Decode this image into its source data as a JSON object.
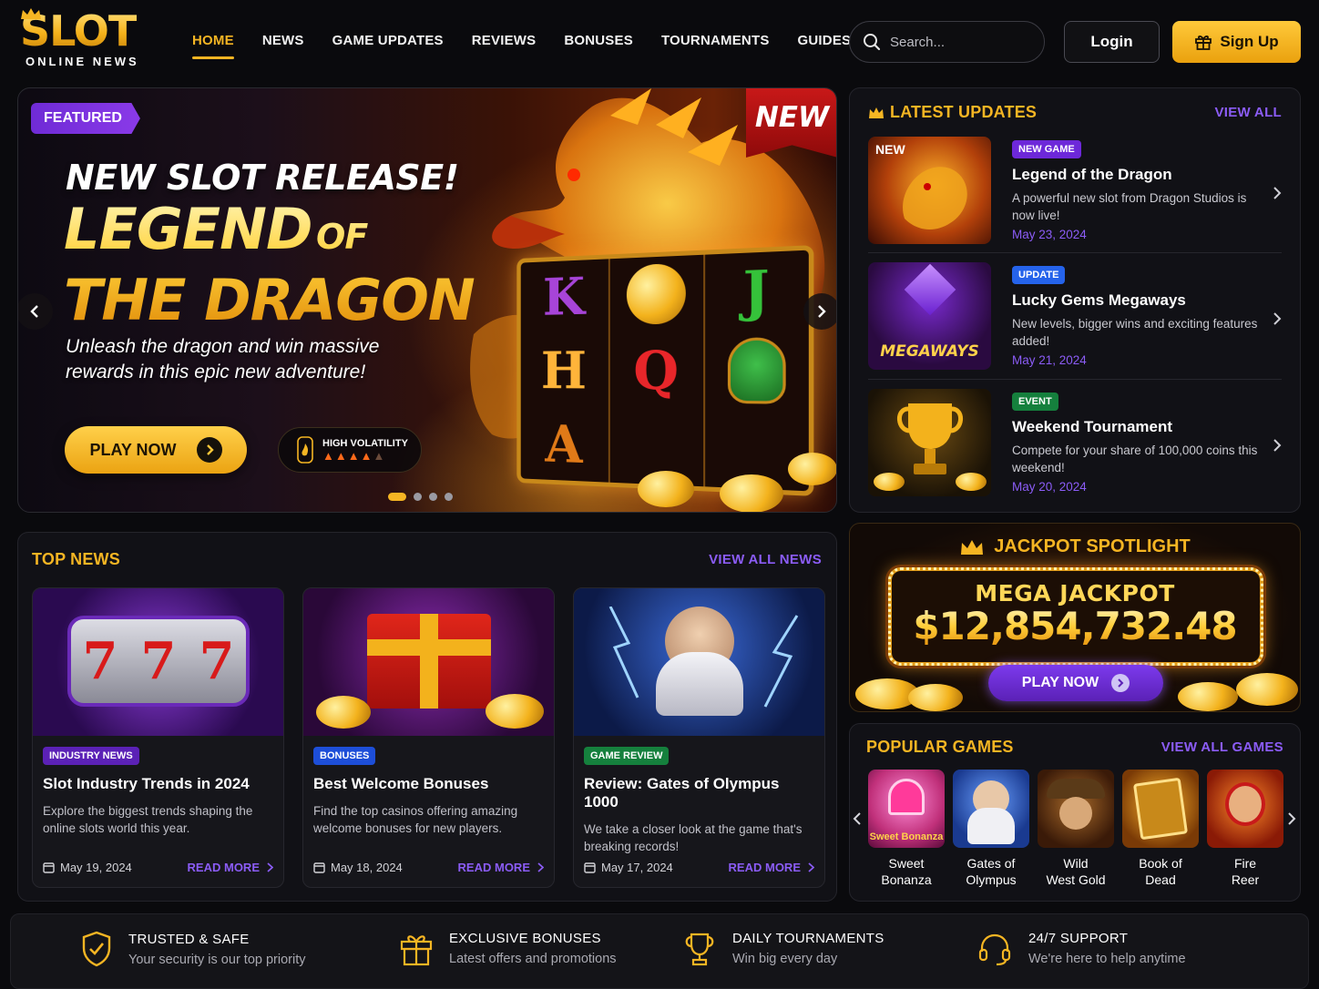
{
  "brand": {
    "name": "SLOT",
    "tagline": "ONLINE NEWS"
  },
  "nav": {
    "items": [
      "HOME",
      "NEWS",
      "GAME UPDATES",
      "REVIEWS",
      "BONUSES",
      "TOURNAMENTS",
      "GUIDES"
    ],
    "active": "HOME"
  },
  "search": {
    "placeholder": "Search..."
  },
  "auth": {
    "login": "Login",
    "signup": "Sign Up"
  },
  "hero": {
    "tag": "FEATURED",
    "ribbon": "NEW",
    "kicker": "NEW SLOT RELEASE!",
    "title_line1": "LEGEND",
    "title_of": "OF",
    "title_line2": "THE DRAGON",
    "subtitle": "Unleash the dragon and win massive rewards in this epic new adventure!",
    "play_label": "PLAY NOW",
    "volatility_label": "HIGH VOLATILITY",
    "volatility_level": 4,
    "volatility_max": 5,
    "slides_total": 4,
    "active_slide": 1,
    "reel_symbols": [
      "K",
      "J",
      "H",
      "Q",
      "A"
    ]
  },
  "updates": {
    "title": "LATEST UPDATES",
    "view_all": "VIEW ALL",
    "items": [
      {
        "badge": "NEW GAME",
        "thumb_badge": "NEW",
        "title": "Legend of the Dragon",
        "desc": "A powerful new slot from Dragon Studios is now live!",
        "date": "May 23, 2024"
      },
      {
        "badge": "UPDATE",
        "thumb_text": "MEGAWAYS",
        "title": "Lucky Gems Megaways",
        "desc": "New levels, bigger wins and exciting features added!",
        "date": "May 21, 2024"
      },
      {
        "badge": "EVENT",
        "title": "Weekend Tournament",
        "desc": "Compete for your share of 100,000 coins this weekend!",
        "date": "May 20, 2024"
      }
    ]
  },
  "top_news": {
    "title": "TOP NEWS",
    "view_all": "VIEW ALL NEWS",
    "read_more": "READ MORE",
    "cards": [
      {
        "badge": "INDUSTRY NEWS",
        "title": "Slot Industry Trends in 2024",
        "desc": "Explore the biggest trends shaping the online slots world this year.",
        "date": "May 19, 2024"
      },
      {
        "badge": "BONUSES",
        "title": "Best Welcome Bonuses",
        "desc": "Find the top casinos offering amazing welcome bonuses for new players.",
        "date": "May 18, 2024"
      },
      {
        "badge": "GAME REVIEW",
        "title": "Review: Gates of Olympus 1000",
        "desc": "We take a closer look at the game that's breaking records!",
        "date": "May 17, 2024"
      }
    ]
  },
  "jackpot": {
    "title": "JACKPOT SPOTLIGHT",
    "label": "MEGA JACKPOT",
    "amount": "$12,854,732.48",
    "play_label": "PLAY NOW"
  },
  "popular": {
    "title": "POPULAR GAMES",
    "view_all": "VIEW ALL GAMES",
    "games": [
      {
        "line1": "Sweet",
        "line2": "Bonanza",
        "thumb_text": "Sweet Bonanza"
      },
      {
        "line1": "Gates of",
        "line2": "Olympus"
      },
      {
        "line1": "Wild",
        "line2": "West Gold"
      },
      {
        "line1": "Book of",
        "line2": "Dead"
      },
      {
        "line1": "Fire",
        "line2": "Reer"
      }
    ]
  },
  "features": [
    {
      "icon": "shield-check-icon",
      "title": "TRUSTED & SAFE",
      "sub": "Your security is our top priority"
    },
    {
      "icon": "gift-icon",
      "title": "EXCLUSIVE BONUSES",
      "sub": "Latest offers and promotions"
    },
    {
      "icon": "trophy-icon",
      "title": "DAILY TOURNAMENTS",
      "sub": "Win big every day"
    },
    {
      "icon": "headset-icon",
      "title": "24/7 SUPPORT",
      "sub": "We're here to help anytime"
    }
  ],
  "colors": {
    "accent": "#f5b523",
    "purple": "#8b5cf6",
    "background": "#0a0a0d",
    "panel": "#111116"
  }
}
